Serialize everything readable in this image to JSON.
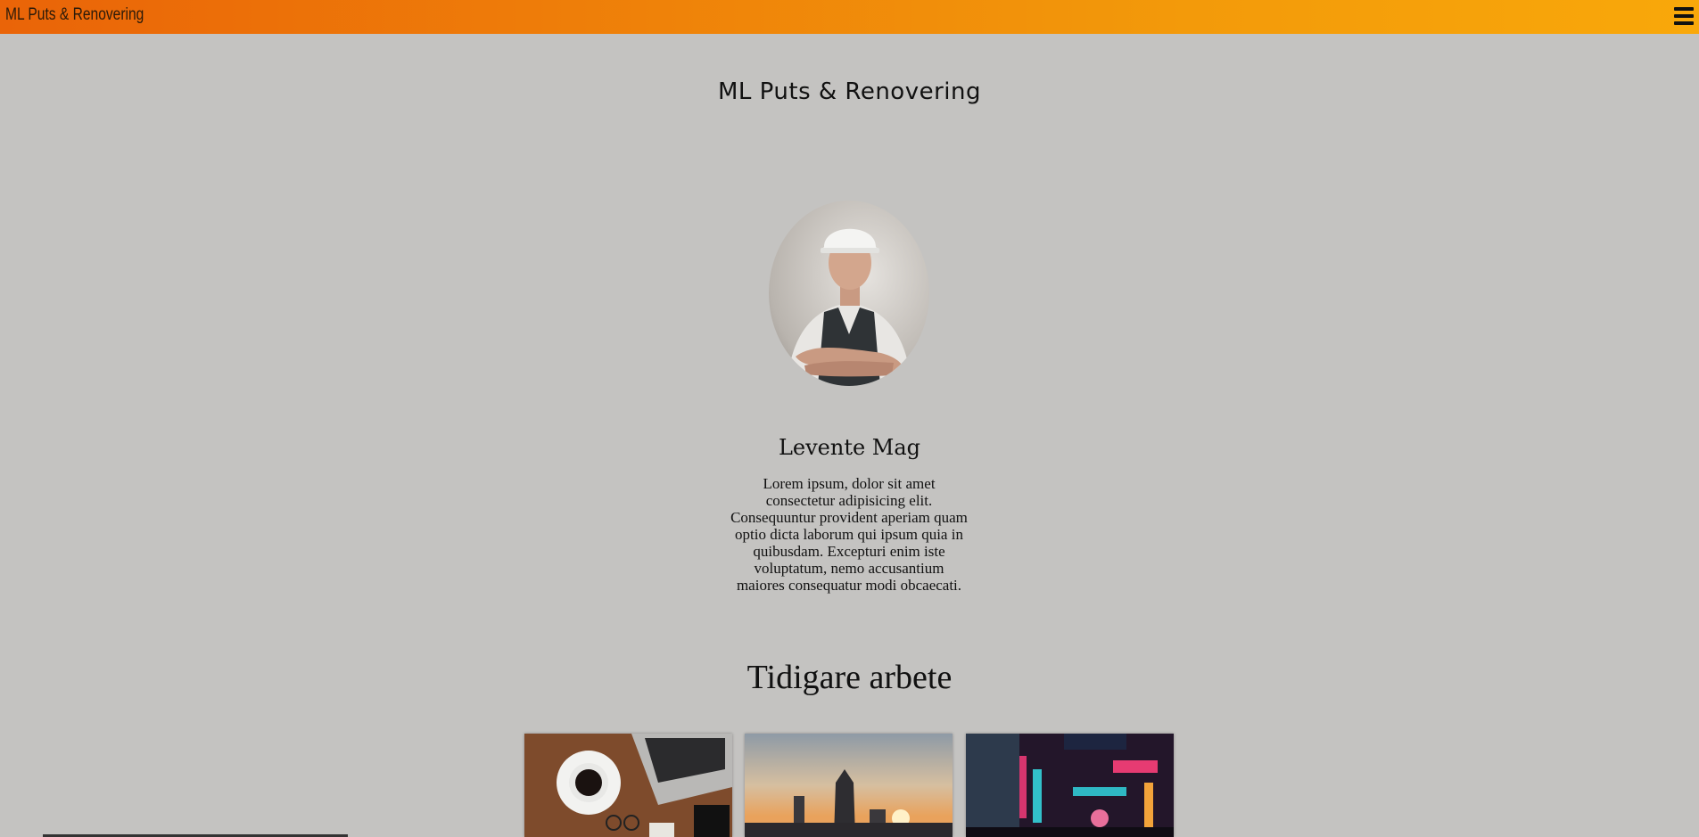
{
  "topbar": {
    "brand": "ML Puts & Renovering",
    "menu_icon": "hamburger-menu-icon",
    "gradient": [
      "#ea6408",
      "#f9a80a"
    ]
  },
  "hero": {
    "site_title": "ML Puts & Renovering"
  },
  "profile": {
    "name": "Levente Mag",
    "bio": "Lorem ipsum, dolor sit amet consectetur adipisicing elit. Consequuntur provident aperiam quam optio dicta laborum qui ipsum quia in quibusdam. Excepturi enim iste voluptatum, nemo accusantium maiores consequatur modi obcaecati."
  },
  "previous_work": {
    "title": "Tidigare arbete",
    "items": [
      {
        "image": "coffee-laptop-desk-photo"
      },
      {
        "image": "city-skyline-sunset-photo"
      },
      {
        "image": "neon-city-street-photo"
      }
    ]
  },
  "colors": {
    "background": "#c4c3c1",
    "accent": "#ea6408"
  }
}
